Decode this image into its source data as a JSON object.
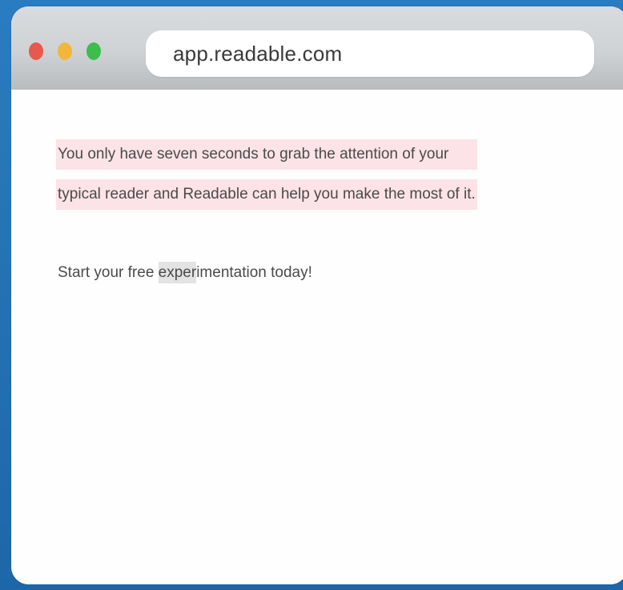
{
  "browser": {
    "url": "app.readable.com"
  },
  "content": {
    "highlighted_lines": [
      "You only have seven seconds to grab the attention of your",
      "typical reader and Readable can help you make the most of it."
    ],
    "cta": {
      "before": "Start your free ",
      "selected": "exper",
      "after": "imentation today!"
    }
  },
  "colors": {
    "highlight": "#fbe3e7",
    "selection": "#e3e3e3",
    "traffic_red": "#e8584c",
    "traffic_yellow": "#f2b73a",
    "traffic_green": "#3dbd4a"
  }
}
